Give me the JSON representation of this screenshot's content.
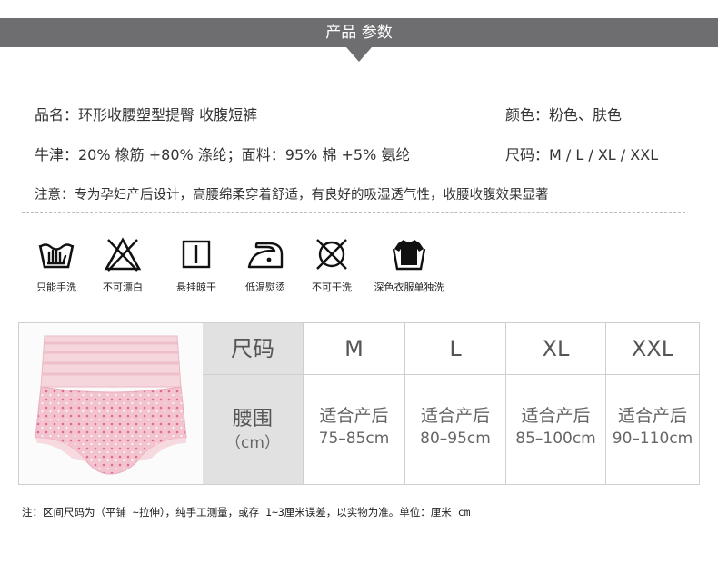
{
  "header": {
    "title": "产品 参数"
  },
  "params": {
    "name": "品名：环形收腰塑型提臀 收腹短裤",
    "color": "颜色：粉色、肤色",
    "material": "牛津：20% 橡筋 +80% 涤纶；面料：95% 棉 +5% 氨纶",
    "sizes": "尺码：M / L / XL / XXL",
    "note": "注意：专为孕妇产后设计，高腰绵柔穿着舒适，有良好的吸湿透气性，收腰收腹效果显著"
  },
  "care": [
    {
      "icon": "hand-wash-icon",
      "label": "只能手洗"
    },
    {
      "icon": "no-bleach-icon",
      "label": "不可漂白"
    },
    {
      "icon": "hang-dry-icon",
      "label": "悬挂晾干"
    },
    {
      "icon": "low-iron-icon",
      "label": "低温熨烫"
    },
    {
      "icon": "no-dry-clean-icon",
      "label": "不可干洗"
    },
    {
      "icon": "wash-dark-separately-icon",
      "label": "深色衣服单独洗"
    }
  ],
  "size_table": {
    "size_header": "尺码",
    "waist_label": "腰围",
    "waist_unit": "（cm）",
    "columns": [
      {
        "size": "M",
        "fit": "适合产后",
        "range": "75–85cm"
      },
      {
        "size": "L",
        "fit": "适合产后",
        "range": "80–95cm"
      },
      {
        "size": "XL",
        "fit": "适合产后",
        "range": "85–100cm"
      },
      {
        "size": "XXL",
        "fit": "适合产后",
        "range": "90–110cm"
      }
    ]
  },
  "footnote": "注：区间尺码为（平铺 ~拉伸），纯手工测量，或存 1~3厘米误差，以实物为准。单位：厘米 cm",
  "colors": {
    "header": "#6e6e70",
    "grey_cell": "#e1e1e1",
    "product_pink": "#f4c9d2"
  }
}
